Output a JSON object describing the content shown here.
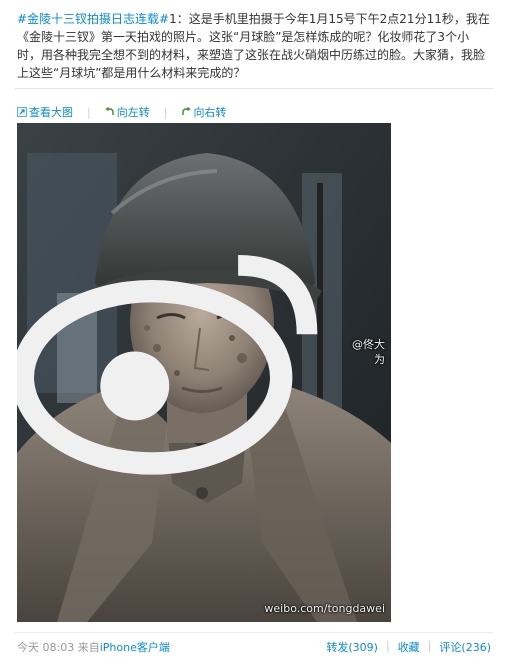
{
  "post": {
    "hashtag": "#金陵十三钗拍摄日志连载#",
    "text": "1：这是手机里拍摄于今年1月15号下午2点21分11秒，我在《金陵十三钗》第一天拍戏的照片。这张“月球脸”是怎样炼成的呢？化妆师花了3个小时，用各种我完全想不到的材料，来塑造了这张在战火硝烟中历练过的脸。大家猜，我脸上这些“月球坑”都是用什么材料来完成的？"
  },
  "toolbar": {
    "view_large": "查看大图",
    "rotate_left": "向左转",
    "rotate_right": "向右转",
    "icons": [
      "magnify-icon",
      "rotate-left-icon",
      "rotate-right-icon"
    ]
  },
  "photo": {
    "watermark_handle": "@佟大为",
    "watermark_url": "weibo.com/tongdawei"
  },
  "footer": {
    "time": "今天 08:03",
    "from_prefix": "来自",
    "source": "iPhone客户端",
    "repost": "转发(309)",
    "favorite": "收藏",
    "comment": "评论(236)"
  },
  "colors": {
    "link": "#0a8cd2",
    "text": "#333333",
    "muted": "#999999"
  }
}
